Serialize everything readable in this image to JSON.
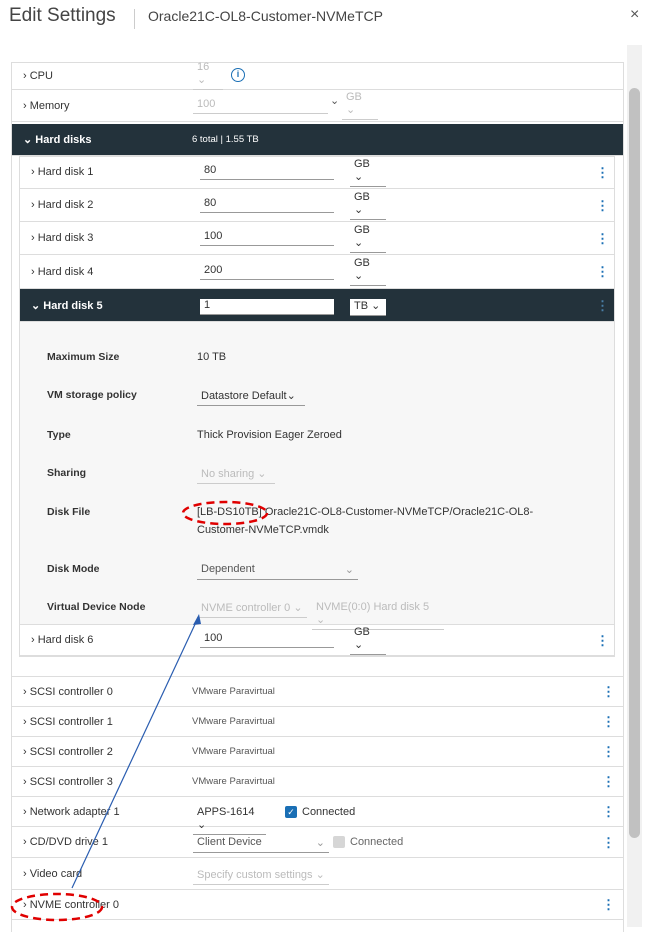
{
  "header": {
    "title": "Edit Settings",
    "vm_name": "Oracle21C-OL8-Customer-NVMeTCP",
    "close": "×"
  },
  "cpu": {
    "label": "CPU",
    "value": "16"
  },
  "memory": {
    "label": "Memory",
    "value": "100",
    "unit": "GB"
  },
  "hard_disks": {
    "label": "Hard disks",
    "summary": "6 total | 1.55 TB",
    "disks": [
      {
        "label": "Hard disk 1",
        "value": "80",
        "unit": "GB"
      },
      {
        "label": "Hard disk 2",
        "value": "80",
        "unit": "GB"
      },
      {
        "label": "Hard disk 3",
        "value": "100",
        "unit": "GB"
      },
      {
        "label": "Hard disk 4",
        "value": "200",
        "unit": "GB"
      },
      {
        "label": "Hard disk 5",
        "value": "1",
        "unit": "TB"
      },
      {
        "label": "Hard disk 6",
        "value": "100",
        "unit": "GB"
      }
    ],
    "details": {
      "max_size_label": "Maximum Size",
      "max_size": "10 TB",
      "policy_label": "VM storage policy",
      "policy": "Datastore Default",
      "type_label": "Type",
      "type": "Thick Provision Eager Zeroed",
      "sharing_label": "Sharing",
      "sharing": "No sharing",
      "file_label": "Disk File",
      "file_line1": "[LB-DS10TB] Oracle21C-OL8-Customer-NVMeTCP/Oracle21C-OL8-",
      "file_line2": "Customer-NVMeTCP.vmdk",
      "mode_label": "Disk Mode",
      "mode": "Dependent",
      "node_label": "Virtual Device Node",
      "node_controller": "NVME controller 0",
      "node_slot": "NVME(0:0) Hard disk 5"
    }
  },
  "devices": [
    {
      "label": "SCSI controller 0",
      "value": "VMware Paravirtual"
    },
    {
      "label": "SCSI controller 1",
      "value": "VMware Paravirtual"
    },
    {
      "label": "SCSI controller 2",
      "value": "VMware Paravirtual"
    },
    {
      "label": "SCSI controller 3",
      "value": "VMware Paravirtual"
    }
  ],
  "network": {
    "label": "Network adapter 1",
    "value": "APPS-1614",
    "connected": "Connected"
  },
  "cdrom": {
    "label": "CD/DVD drive 1",
    "value": "Client Device",
    "connected": "Connected"
  },
  "video": {
    "label": "Video card",
    "value": "Specify custom settings"
  },
  "nvme": {
    "label": "NVME controller 0"
  },
  "colors": {
    "accent": "#1a6fb5",
    "dark_header": "#23323b",
    "annotation_red": "#e00000",
    "annotation_blue": "#2a5db0"
  }
}
